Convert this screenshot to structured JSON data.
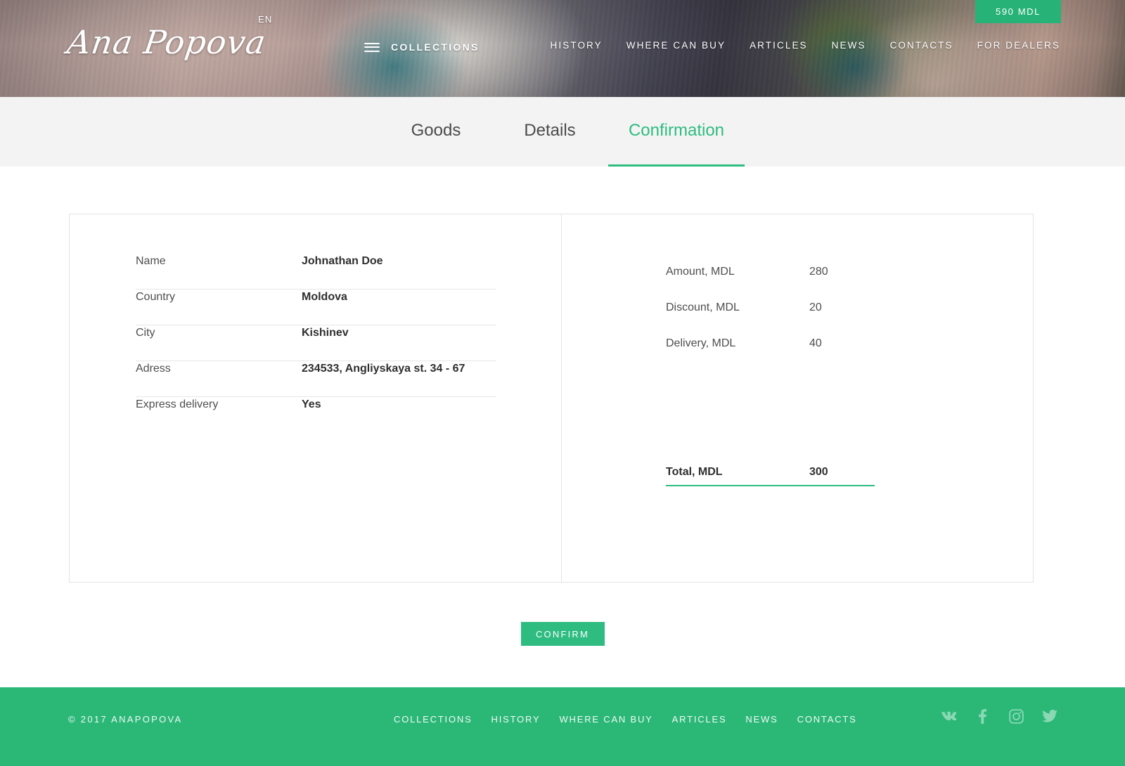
{
  "header": {
    "logo_text": "Ana Popova",
    "language": "EN",
    "collections_label": "COLLECTIONS",
    "burger_icon": "hamburger-menu-icon",
    "cart_total": "590 MDL",
    "nav": [
      {
        "label": "HISTORY"
      },
      {
        "label": "WHERE CAN BUY"
      },
      {
        "label": "ARTICLES"
      },
      {
        "label": "NEWS"
      },
      {
        "label": "CONTACTS"
      },
      {
        "label": "FOR DEALERS"
      }
    ]
  },
  "tabs": [
    {
      "label": "Goods",
      "active": false
    },
    {
      "label": "Details",
      "active": false
    },
    {
      "label": "Confirmation",
      "active": true
    }
  ],
  "order_details": [
    {
      "key": "Name",
      "value": "Johnathan Doe"
    },
    {
      "key": "Country",
      "value": "Moldova"
    },
    {
      "key": "City",
      "value": "Kishinev"
    },
    {
      "key": "Adress",
      "value": "234533, Angliyskaya st. 34 - 67"
    },
    {
      "key": "Express delivery",
      "value": "Yes"
    }
  ],
  "order_summary": [
    {
      "key": "Amount, MDL",
      "value": "280"
    },
    {
      "key": "Discount, MDL",
      "value": "20"
    },
    {
      "key": "Delivery, MDL",
      "value": "40"
    }
  ],
  "order_total": {
    "key": "Total, MDL",
    "value": "300"
  },
  "confirm_button": "CONFIRM",
  "footer": {
    "copyright": "© 2017  ANAPOPOVA",
    "nav": [
      {
        "label": "COLLECTIONS"
      },
      {
        "label": "HISTORY"
      },
      {
        "label": "WHERE CAN BUY"
      },
      {
        "label": "ARTICLES"
      },
      {
        "label": "NEWS"
      },
      {
        "label": "CONTACTS"
      }
    ],
    "socials": [
      {
        "name": "vk-icon"
      },
      {
        "name": "facebook-icon"
      },
      {
        "name": "instagram-icon"
      },
      {
        "name": "twitter-icon"
      }
    ]
  },
  "colors": {
    "brand_green": "#2bb877",
    "accent_green": "#2ebc81",
    "tabbar_bg": "#f3f3f3",
    "border": "#e3e3e3"
  }
}
